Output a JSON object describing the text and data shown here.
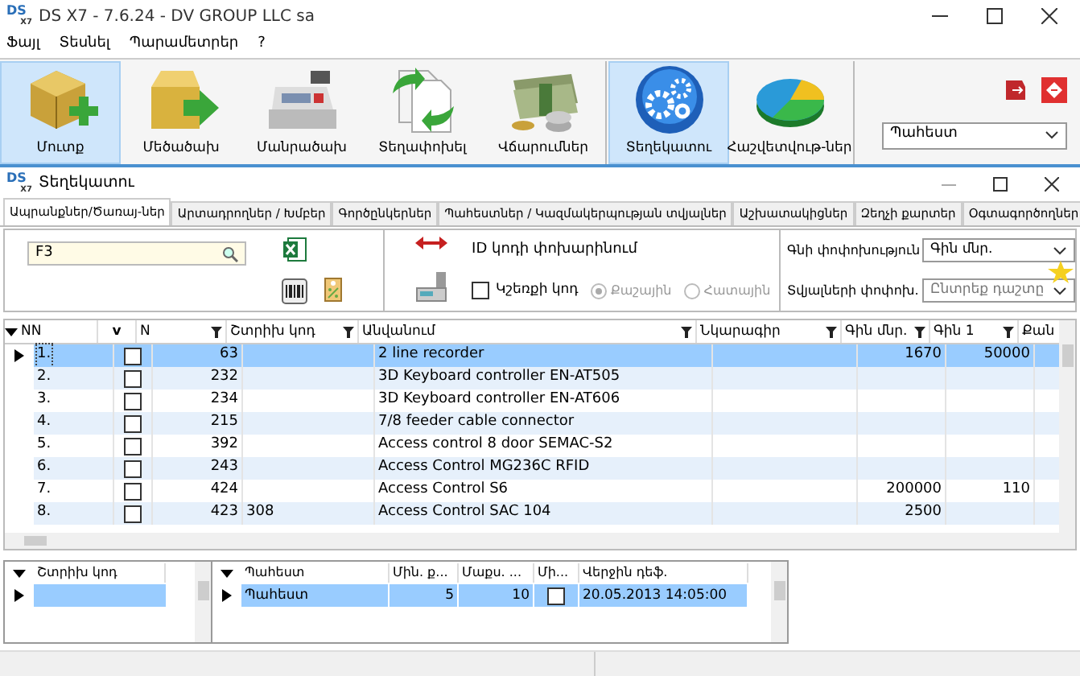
{
  "window": {
    "logo": "DS",
    "logo_sub": "X7",
    "title": "DS X7 - 7.6.24 - DV GROUP LLC sa"
  },
  "menu": [
    "Ֆայլ",
    "Տեսնել",
    "Պարամետրեր",
    "?"
  ],
  "toolbar": [
    {
      "label": "Մուտք",
      "kind": "box-plus",
      "selected": true
    },
    {
      "label": "Մեծածախ",
      "kind": "box-arrow",
      "selected": false
    },
    {
      "label": "Մանրածախ",
      "kind": "register",
      "selected": false
    },
    {
      "label": "Տեղափոխել",
      "kind": "documents",
      "selected": false
    },
    {
      "label": "Վճարումներ",
      "kind": "money",
      "selected": false
    },
    {
      "label": "Տեղեկատու",
      "kind": "gears",
      "selected": true
    },
    {
      "label": "Հաշվետվութ-ներ",
      "kind": "pie",
      "selected": false
    }
  ],
  "warehouse_select": {
    "value": "Պահեստ"
  },
  "child_window": {
    "logo": "DS",
    "logo_sub": "X7",
    "title": "Տեղեկատու"
  },
  "tabs": [
    {
      "label": "Ապրանքներ/Ծառայ-ներ",
      "selected": true
    },
    {
      "label": "Արտադրողներ / Խմբեր",
      "selected": false
    },
    {
      "label": "Գործընկերներ",
      "selected": false
    },
    {
      "label": "Պահեստներ / Կազմակերպության տվյալներ",
      "selected": false
    },
    {
      "label": "Աշխատակիցներ",
      "selected": false
    },
    {
      "label": "Զեղչի քարտեր",
      "selected": false
    },
    {
      "label": "Օգտագործողներ",
      "selected": false
    }
  ],
  "search": {
    "value": "F3"
  },
  "id_code": {
    "label": "ID կոդի փոխարինում"
  },
  "scale_code": {
    "label": "Կշեռքի կոդ",
    "checked": false
  },
  "radios": [
    {
      "label": "Քաշային",
      "selected": true,
      "disabled": true
    },
    {
      "label": "Հատային",
      "selected": false,
      "disabled": true
    }
  ],
  "price_change": {
    "label": "Գնի փոփոխություն",
    "value": "Գին մնր."
  },
  "data_change": {
    "label": "Տվյալների փոփոխ.",
    "placeholder": "Ընտրեք դաշտը"
  },
  "table": {
    "columns": [
      "NN",
      "v",
      "N",
      "Շտրիխ կոդ",
      "Անվանում",
      "Նկարագիր",
      "Գին մնր.",
      "Գին 1",
      "Քան"
    ],
    "rows": [
      {
        "nn": "1.",
        "checked": false,
        "n": "63",
        "barcode": "",
        "name": "2 line recorder",
        "price_retail": "1670",
        "price_1": "50000",
        "selected": true
      },
      {
        "nn": "2.",
        "checked": false,
        "n": "232",
        "barcode": "",
        "name": "3D Keyboard controller EN-AT505",
        "price_retail": "",
        "price_1": "",
        "selected": false
      },
      {
        "nn": "3.",
        "checked": false,
        "n": "234",
        "barcode": "",
        "name": "3D Keyboard controller EN-AT606",
        "price_retail": "",
        "price_1": "",
        "selected": false
      },
      {
        "nn": "4.",
        "checked": false,
        "n": "215",
        "barcode": "",
        "name": "7/8 feeder cable connector",
        "price_retail": "",
        "price_1": "",
        "selected": false
      },
      {
        "nn": "5.",
        "checked": false,
        "n": "392",
        "barcode": "",
        "name": "Access control 8 door SEMAC-S2",
        "price_retail": "",
        "price_1": "",
        "selected": false
      },
      {
        "nn": "6.",
        "checked": false,
        "n": "243",
        "barcode": "",
        "name": "Access Control MG236C RFID",
        "price_retail": "",
        "price_1": "",
        "selected": false
      },
      {
        "nn": "7.",
        "checked": false,
        "n": "424",
        "barcode": "",
        "name": "Access Control S6",
        "price_retail": "200000",
        "price_1": "110",
        "selected": false
      },
      {
        "nn": "8.",
        "checked": false,
        "n": "423",
        "barcode": "308",
        "name": "Access Control SAC 104",
        "price_retail": "2500",
        "price_1": "",
        "selected": false
      }
    ]
  },
  "barcodes_table": {
    "columns": [
      "Շտրիխ կոդ"
    ]
  },
  "stock_table": {
    "columns": [
      "Պահեստ",
      "Մին. ք...",
      "Մաքս. ...",
      "Մի...",
      "Վերջին դեֆ."
    ],
    "rows": [
      {
        "warehouse": "Պահեստ",
        "min": "5",
        "max": "10",
        "checked": false,
        "last": "20.05.2013 14:05:00",
        "selected": true
      }
    ]
  }
}
